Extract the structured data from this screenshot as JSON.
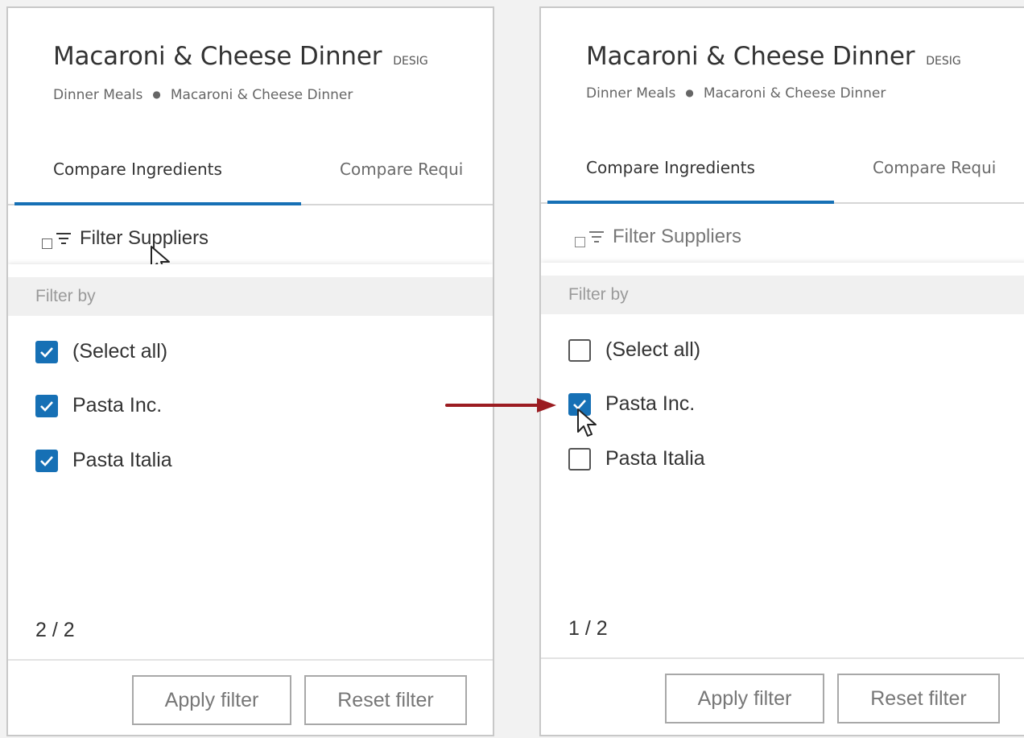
{
  "panels": [
    {
      "title": "Macaroni & Cheese Dinner",
      "badge": "DESIG",
      "breadcrumb": [
        "Dinner Meals",
        "Macaroni & Cheese Dinner"
      ],
      "tabs": [
        "Compare Ingredients",
        "Compare Requi"
      ],
      "filter_toggle": "Filter Suppliers",
      "filter_by": "Filter by",
      "options": [
        {
          "label": "(Select all)",
          "checked": true
        },
        {
          "label": "Pasta Inc.",
          "checked": true
        },
        {
          "label": "Pasta Italia",
          "checked": true
        }
      ],
      "count": "2 / 2",
      "apply_label": "Apply filter",
      "reset_label": "Reset filter"
    },
    {
      "title": "Macaroni & Cheese Dinner",
      "badge": "DESIG",
      "breadcrumb": [
        "Dinner Meals",
        "Macaroni & Cheese Dinner"
      ],
      "tabs": [
        "Compare Ingredients",
        "Compare Requi"
      ],
      "filter_toggle": "Filter Suppliers",
      "filter_by": "Filter by",
      "options": [
        {
          "label": "(Select all)",
          "checked": false
        },
        {
          "label": "Pasta Inc.",
          "checked": true
        },
        {
          "label": "Pasta Italia",
          "checked": false
        }
      ],
      "count": "1 / 2",
      "apply_label": "Apply filter",
      "reset_label": "Reset filter"
    }
  ],
  "colors": {
    "accent": "#1670b5",
    "arrow": "#9b1c21"
  },
  "icons": [
    "filter-icon",
    "checkmark-icon",
    "mouse-pointer-icon",
    "right-arrow-icon"
  ]
}
